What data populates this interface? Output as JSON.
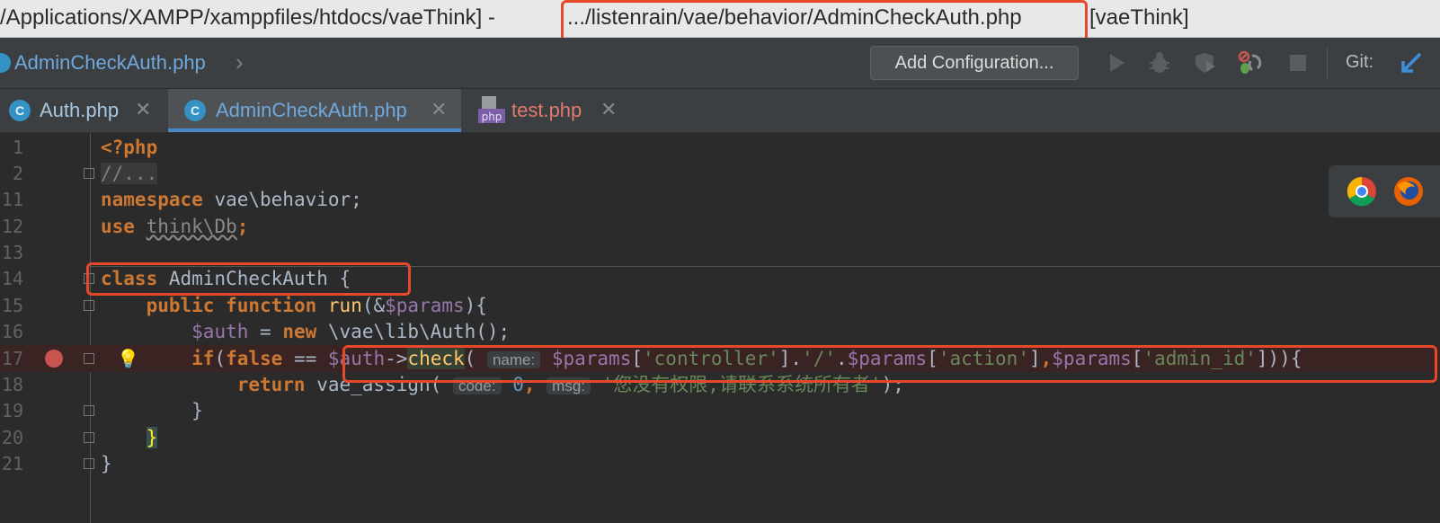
{
  "window": {
    "title_prefix": "/Applications/XAMPP/xamppfiles/htdocs/vaeThink] - ",
    "title_path": ".../listenrain/vae/behavior/AdminCheckAuth.php",
    "title_suffix": "[vaeThink]"
  },
  "navbar": {
    "breadcrumb": "AdminCheckAuth.php",
    "add_configuration": "Add Configuration...",
    "git_label": "Git:",
    "icons": [
      "run-icon",
      "debug-icon",
      "coverage-icon",
      "profiler-icon",
      "stop-icon",
      "vcs-update-icon"
    ]
  },
  "tabs": [
    {
      "label": "Auth.php",
      "icon": "C",
      "active": false
    },
    {
      "label": "AdminCheckAuth.php",
      "icon": "C",
      "active": true
    },
    {
      "label": "test.php",
      "icon": "php",
      "active": false
    }
  ],
  "editor": {
    "line_numbers": [
      "1",
      "2",
      "11",
      "12",
      "13",
      "14",
      "15",
      "16",
      "17",
      "18",
      "19",
      "20",
      "21"
    ],
    "lines": {
      "l1": "<?php",
      "l2": "//...",
      "l11_kw": "namespace",
      "l11_rest": " vae\\behavior;",
      "l12_kw": "use",
      "l12_rest": "think\\Db",
      "l12_end": ";",
      "l14_kw": "class",
      "l14_rest": " AdminCheckAuth {",
      "l15_kw1": "public",
      "l15_kw2": "function",
      "l15_fn": "run",
      "l15_a": "(&",
      "l15_var": "$params",
      "l15_b": "){",
      "l16_var": "$auth",
      "l16_a": " = ",
      "l16_kw": "new",
      "l16_b": " \\vae\\lib\\Auth();",
      "l17_kw1": "if",
      "l17_a": "(",
      "l17_kw2": "false",
      "l17_b": " == ",
      "l17_var1": "$auth",
      "l17_c": "->",
      "l17_fn": "check",
      "l17_d": "( ",
      "l17_hint": "name:",
      "l17_var2": "$params",
      "l17_s1": "'controller'",
      "l17_e": ".",
      "l17_s2": "'/'",
      "l17_var3": "$params",
      "l17_s3": "'action'",
      "l17_f": ",",
      "l17_var4": "$params",
      "l17_s4": "'admin_id'",
      "l17_g": "])){",
      "l18_kw": "return",
      "l18_a": " vae_assign( ",
      "l18_hint1": "code:",
      "l18_num": "0",
      "l18_hint2": "msg:",
      "l18_str": "'您没有权限,请联系系统所有者'",
      "l18_end": ");",
      "l19": "}",
      "l20": "}",
      "l21": "}"
    }
  },
  "browsers": [
    "chrome-icon",
    "firefox-icon"
  ],
  "colors": {
    "highlight": "#e5492a",
    "accent": "#4a88c7"
  }
}
